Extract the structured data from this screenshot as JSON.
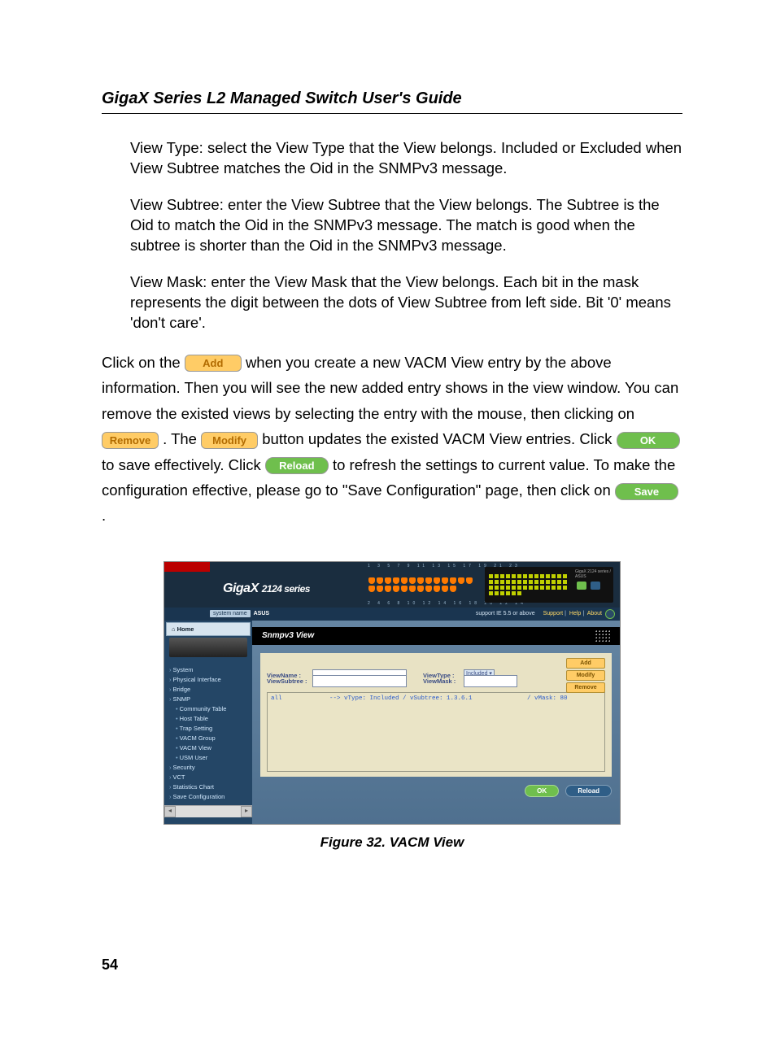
{
  "doc": {
    "title": "GigaX Series L2 Managed Switch User's Guide",
    "page_number": "54",
    "figure_caption": "Figure 32.   VACM View"
  },
  "paragraphs": {
    "p1": "View Type: select the View Type that the View belongs. Included or Excluded when View Subtree matches the Oid in the SNMPv3 message.",
    "p2": "View Subtree: enter the View Subtree that the View belongs. The Subtree is the Oid to match the Oid in the SNMPv3 message. The match is good when the subtree is shorter than the Oid in the SNMPv3 message.",
    "p3": "View Mask: enter the View Mask that the View belongs. Each bit in the mask represents the digit between the dots of View Subtree from left side. Bit '0' means 'don't care'.",
    "p4_a": "Click on the ",
    "p4_b": " when you create a new VACM View entry by the above information. Then you will see the new added entry shows in the view window. You can remove the existed views by selecting the entry with the mouse, then clicking on ",
    "p4_c": ". The ",
    "p4_d": " button updates the existed VACM View entries. Click ",
    "p4_e": " to save effectively. Click ",
    "p4_f": " to refresh the settings to current value. To make the configuration effective, please go to \"Save Configuration\" page, then click on ",
    "p4_g": "."
  },
  "inline_buttons": {
    "add": "Add",
    "remove": "Remove",
    "modify": "Modify",
    "ok": "OK",
    "reload": "Reload",
    "save": "Save"
  },
  "figure": {
    "logo_main": "Giga",
    "logo_x": "X",
    "logo_series": "2124 series",
    "port_numbers_top": "1  3  5  7  9  11 13 15 17 19 21 23",
    "port_numbers_bottom": "2  4  6  8  10 12 14 16 18 20 22 24",
    "status_text": "GigaX 2124 series / ASUS",
    "system_name_label": "system name",
    "system_name_value": "ASUS",
    "support_text": "support IE 5.5 or above",
    "top_links": {
      "a": "Support",
      "b": "Help",
      "c": "About"
    },
    "home_label": "⌂ Home",
    "nav": [
      {
        "label": "System",
        "sub": false
      },
      {
        "label": "Physical Interface",
        "sub": false
      },
      {
        "label": "Bridge",
        "sub": false
      },
      {
        "label": "SNMP",
        "sub": false
      },
      {
        "label": "Community Table",
        "sub": true
      },
      {
        "label": "Host Table",
        "sub": true
      },
      {
        "label": "Trap Setting",
        "sub": true
      },
      {
        "label": "VACM Group",
        "sub": true
      },
      {
        "label": "VACM View",
        "sub": true
      },
      {
        "label": "USM User",
        "sub": true
      },
      {
        "label": "Security",
        "sub": false
      },
      {
        "label": "VCT",
        "sub": false
      },
      {
        "label": "Statistics Chart",
        "sub": false
      },
      {
        "label": "Save Configuration",
        "sub": false
      }
    ],
    "panel_title": "Snmpv3 View",
    "form": {
      "view_name_label": "ViewName :",
      "view_type_label": "ViewType :",
      "view_type_value": "Included",
      "view_subtree_label": "ViewSubtree :",
      "view_mask_label": "ViewMask :",
      "btn_add": "Add",
      "btn_modify": "Modify",
      "btn_remove": "Remove"
    },
    "listing_text": "all             --> vType: Included / vSubtree: 1.3.6.1               / vMask: 80",
    "bottom": {
      "ok": "OK",
      "reload": "Reload"
    }
  }
}
